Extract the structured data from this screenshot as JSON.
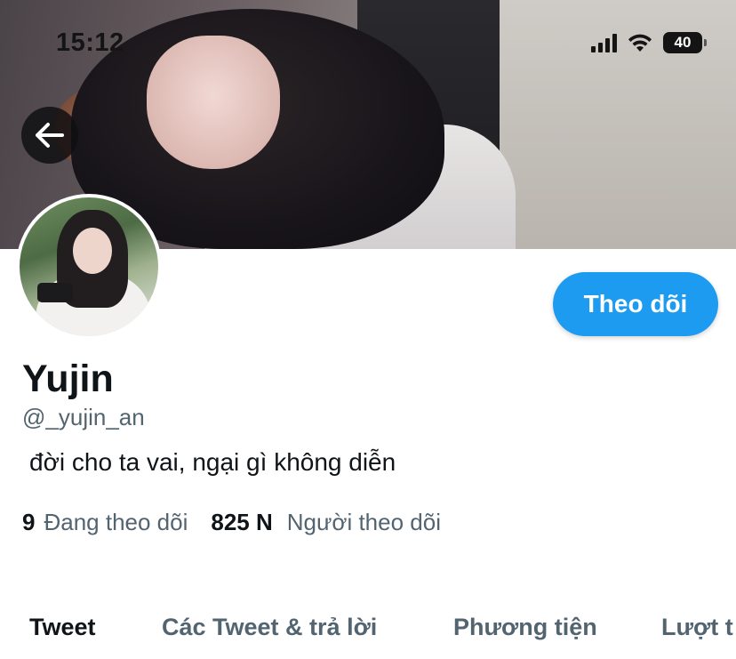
{
  "status_bar": {
    "time": "15:12",
    "battery": "40",
    "icons": [
      "signal-icon",
      "wifi-icon",
      "battery-icon"
    ]
  },
  "header": {
    "back_icon": "arrow-left-icon"
  },
  "profile": {
    "display_name": "Yujin",
    "handle": "@_yujin_an",
    "bio": "đời cho ta vai, ngại gì không diễn",
    "follow_label": "Theo dõi",
    "following_count": "9",
    "following_label": "Đang theo dõi",
    "followers_count": "825 N",
    "followers_label": "Người theo dõi"
  },
  "tabs": [
    {
      "label": "Tweet",
      "active": true
    },
    {
      "label": "Các Tweet & trả lời",
      "active": false
    },
    {
      "label": "Phương tiện",
      "active": false
    },
    {
      "label": "Lượt t",
      "active": false
    }
  ],
  "colors": {
    "accent": "#1d9bf0",
    "text_primary": "#0f1419",
    "text_secondary": "#536471"
  }
}
